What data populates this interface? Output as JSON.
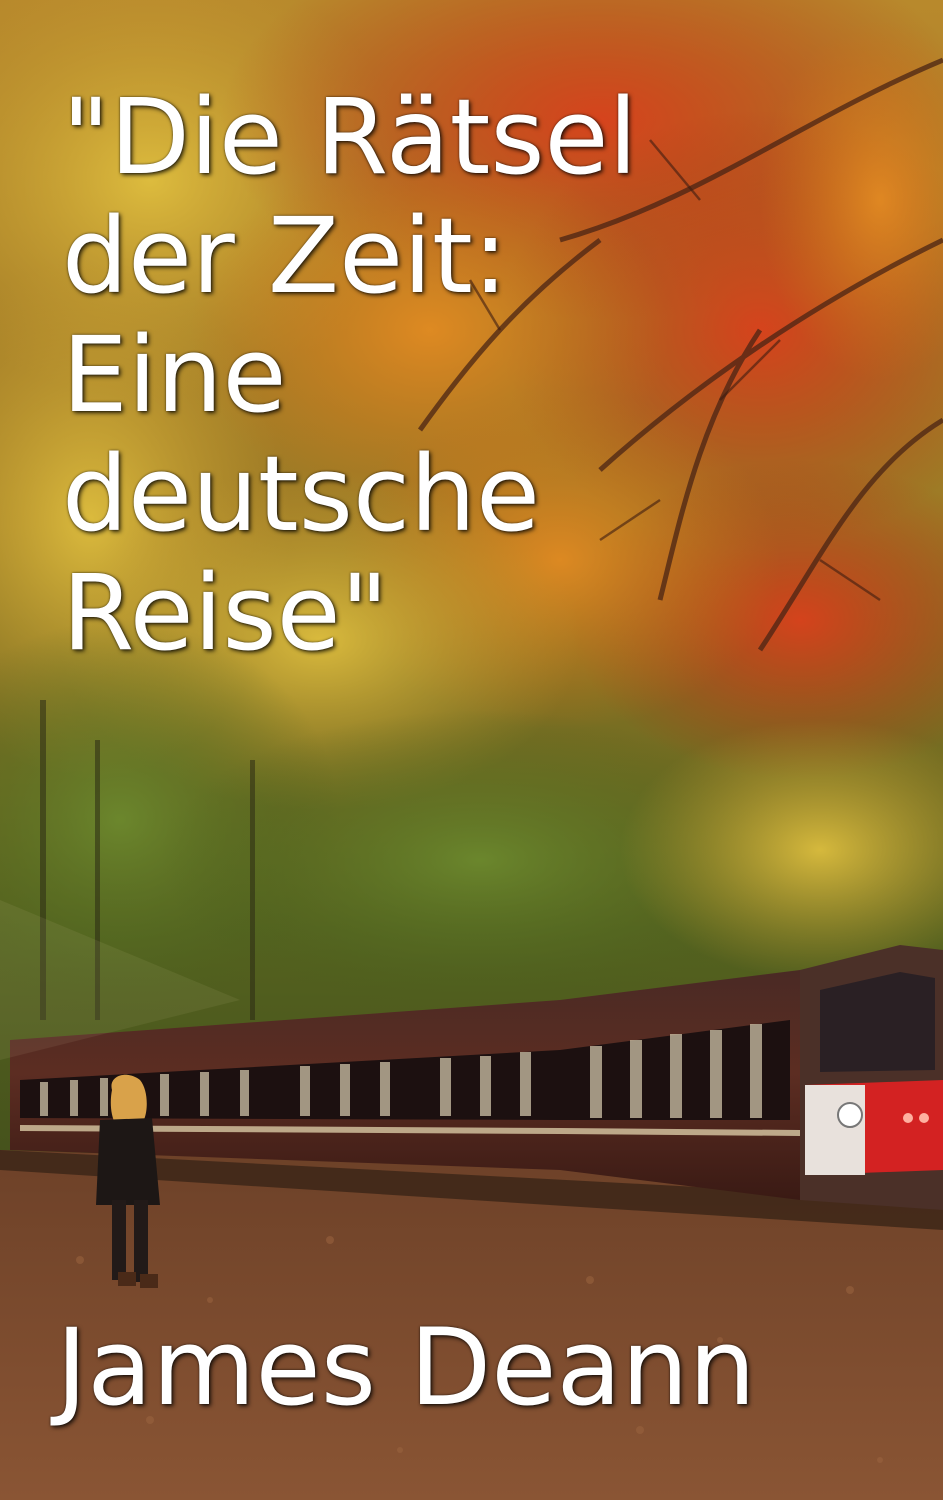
{
  "cover": {
    "title_lines": [
      "\"Die Rätsel",
      "der Zeit:",
      "Eine",
      "deutsche",
      "Reise\""
    ],
    "author": "James Deann"
  },
  "palette": {
    "foliage_red": "#c0391a",
    "foliage_orange": "#e07a1f",
    "foliage_yellow": "#d9b23a",
    "foliage_green": "#5f7d2c",
    "train_body": "#5a2a22",
    "train_front_red": "#d32222",
    "ground": "#7a4a2e",
    "text": "#ffffff"
  }
}
